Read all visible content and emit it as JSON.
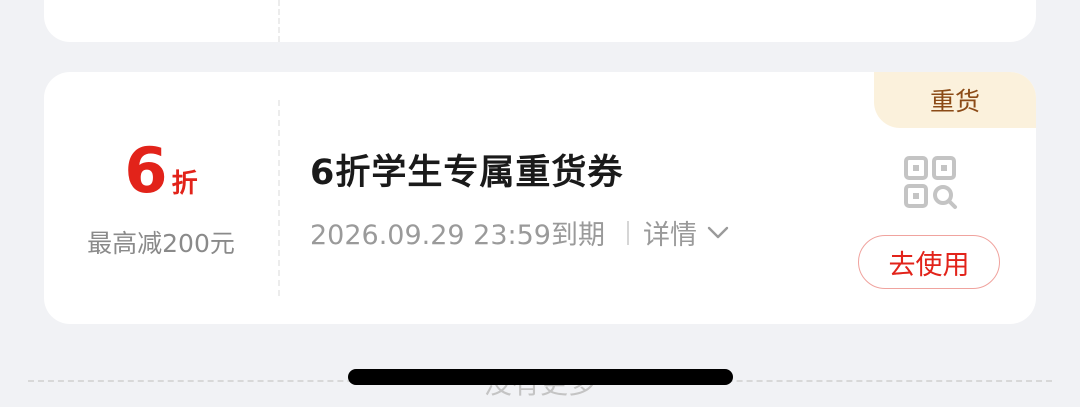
{
  "coupon": {
    "discount_number": "6",
    "discount_unit": "折",
    "max_reduce": "最高减200元",
    "title": "6折学生专属重货券",
    "expiry": "2026.09.29 23:59到期",
    "details_label": "详情",
    "tag": "重货",
    "use_button": "去使用",
    "qr_icon": "qr-code-scan-icon"
  },
  "footer": {
    "no_more": "没有更多"
  },
  "colors": {
    "accent": "#e2231a",
    "tag_bg": "#fbf1dc",
    "tag_text": "#8b4a16",
    "page_bg": "#f1f2f5"
  }
}
